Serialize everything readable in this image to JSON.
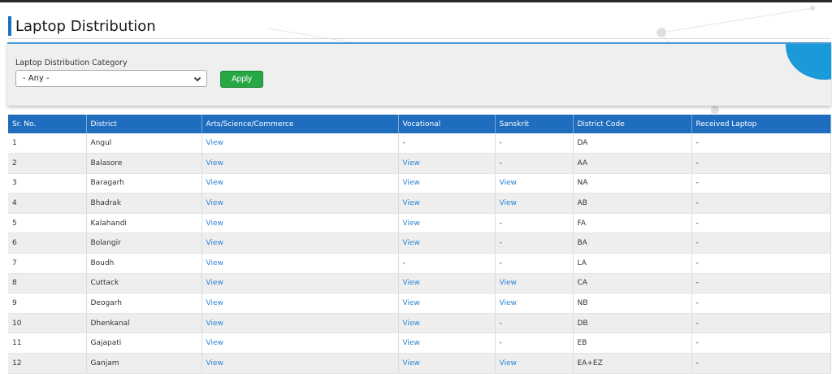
{
  "page": {
    "title": "Laptop Distribution"
  },
  "filter": {
    "label": "Laptop Distribution Category",
    "selected": "- Any -",
    "apply_label": "Apply",
    "icon": "filter-lines-icon"
  },
  "colors": {
    "header": "#1f6dbf",
    "apply": "#28a745",
    "link": "#2a84d2",
    "accent": "#1b9ad9"
  },
  "table": {
    "headers": [
      "Sr. No.",
      "District",
      "Arts/Science/Commerce",
      "Vocational",
      "Sanskrit",
      "District Code",
      "Received Laptop"
    ],
    "rows": [
      [
        "1",
        "Angul",
        "View",
        "-",
        "-",
        "DA",
        "-"
      ],
      [
        "2",
        "Balasore",
        "View",
        "View",
        "-",
        "AA",
        "-"
      ],
      [
        "3",
        "Baragarh",
        "View",
        "View",
        "View",
        "NA",
        "-"
      ],
      [
        "4",
        "Bhadrak",
        "View",
        "View",
        "View",
        "AB",
        "-"
      ],
      [
        "5",
        "Kalahandi",
        "View",
        "View",
        "-",
        "FA",
        "-"
      ],
      [
        "6",
        "Bolangir",
        "View",
        "View",
        "-",
        "BA",
        "-"
      ],
      [
        "7",
        "Boudh",
        "View",
        "-",
        "-",
        "LA",
        "-"
      ],
      [
        "8",
        "Cuttack",
        "View",
        "View",
        "View",
        "CA",
        "-"
      ],
      [
        "9",
        "Deogarh",
        "View",
        "View",
        "View",
        "NB",
        "-"
      ],
      [
        "10",
        "Dhenkanal",
        "View",
        "View",
        "-",
        "DB",
        "-"
      ],
      [
        "11",
        "Gajapati",
        "View",
        "View",
        "-",
        "EB",
        "-"
      ],
      [
        "12",
        "Ganjam",
        "View",
        "View",
        "View",
        "EA+EZ",
        "-"
      ]
    ]
  }
}
